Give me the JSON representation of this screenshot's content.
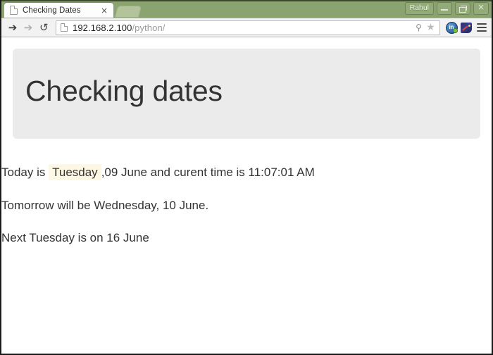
{
  "browser": {
    "tab": {
      "title": "Checking Dates",
      "favicon": "page-icon",
      "close_label": "×"
    },
    "new_tab_label": "+",
    "window_controls": {
      "user": "Rahul",
      "minimize": "–",
      "maximize": "❐",
      "close": "×"
    },
    "nav": {
      "back": "←",
      "forward": "→",
      "reload": "↺"
    },
    "address_bar": {
      "host": "192.168.2.100",
      "path": "/python/",
      "full_url": "192.168.2.100/python/",
      "search_icon": "⌕",
      "bookmark_icon": "★"
    },
    "toolbar_icons": [
      "extension-linkedin-icon",
      "extension-dashboard-icon",
      "menu-icon"
    ]
  },
  "page": {
    "heading": "Checking dates",
    "line1": {
      "prefix": "Today is",
      "highlight": "Tuesday",
      "suffix": ",09 June and curent time is 11:07:01 AM",
      "highlight_color": "#fcf8e3"
    },
    "line2": "Tomorrow will be Wednesday, 10 June.",
    "line3": "Next Tuesday is on 16 June",
    "jumbotron_color": "#ebebeb",
    "text_color": "#333333"
  }
}
